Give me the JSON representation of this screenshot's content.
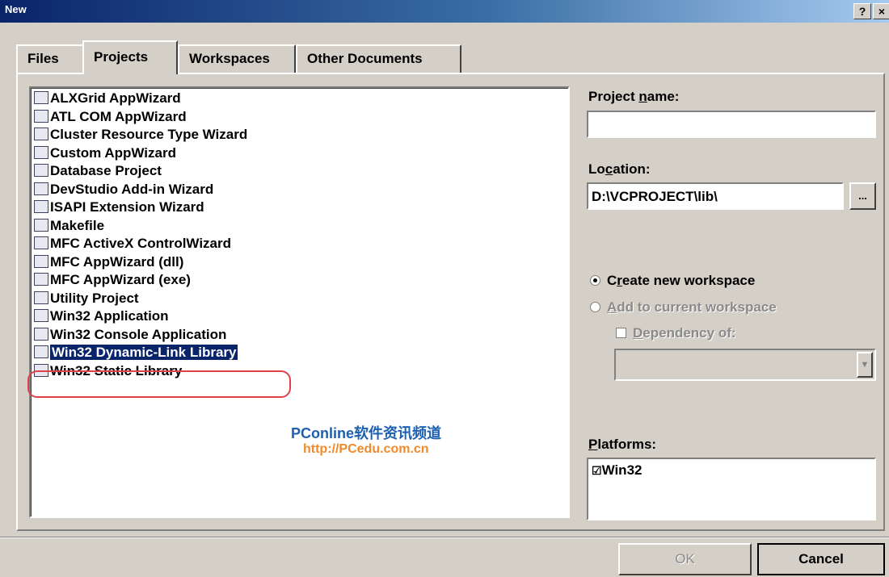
{
  "window": {
    "title": "New",
    "help_btn": "?",
    "close_btn": "×"
  },
  "tabs": [
    "Files",
    "Projects",
    "Workspaces",
    "Other Documents"
  ],
  "active_tab": "Projects",
  "projects": [
    {
      "label": "ALXGrid AppWizard",
      "icon": "grid-icon"
    },
    {
      "label": "ATL COM AppWizard",
      "icon": "atl-icon"
    },
    {
      "label": "Cluster Resource Type Wizard",
      "icon": "cluster-icon"
    },
    {
      "label": "Custom AppWizard",
      "icon": "custom-wizard-icon"
    },
    {
      "label": "Database Project",
      "icon": "database-icon"
    },
    {
      "label": "DevStudio Add-in Wizard",
      "icon": "addin-icon"
    },
    {
      "label": "ISAPI Extension Wizard",
      "icon": "globe-icon"
    },
    {
      "label": "Makefile",
      "icon": "makefile-icon"
    },
    {
      "label": "MFC ActiveX ControlWizard",
      "icon": "activex-icon"
    },
    {
      "label": "MFC AppWizard (dll)",
      "icon": "mfc-dll-icon"
    },
    {
      "label": "MFC AppWizard (exe)",
      "icon": "mfc-exe-icon"
    },
    {
      "label": "Utility Project",
      "icon": "utility-icon"
    },
    {
      "label": "Win32 Application",
      "icon": "win32-app-icon"
    },
    {
      "label": "Win32 Console Application",
      "icon": "console-icon"
    },
    {
      "label": "Win32 Dynamic-Link Library",
      "icon": "dll-icon",
      "selected": true
    },
    {
      "label": "Win32 Static Library",
      "icon": "static-lib-icon"
    }
  ],
  "project_name": {
    "label_pre": "Project ",
    "label_u": "n",
    "label_post": "ame:",
    "value": ""
  },
  "location": {
    "label_pre": "Lo",
    "label_u": "c",
    "label_post": "ation:",
    "value": "D:\\VCPROJECT\\lib\\",
    "browse": "..."
  },
  "workspace": {
    "create": {
      "pre": "C",
      "u": "r",
      "post": "eate new workspace",
      "checked": true
    },
    "add": {
      "u": "A",
      "post": "dd to current workspace",
      "enabled": false
    },
    "dependency": {
      "u": "D",
      "post": "ependency of:",
      "enabled": false
    }
  },
  "platforms": {
    "label_u": "P",
    "label_post": "latforms:",
    "items": [
      {
        "label": "Win32",
        "checked": true
      }
    ]
  },
  "watermark": {
    "line1": "PConline软件资讯频道",
    "line2": "http://PCedu.com.cn"
  },
  "buttons": {
    "ok": "OK",
    "cancel": "Cancel"
  }
}
